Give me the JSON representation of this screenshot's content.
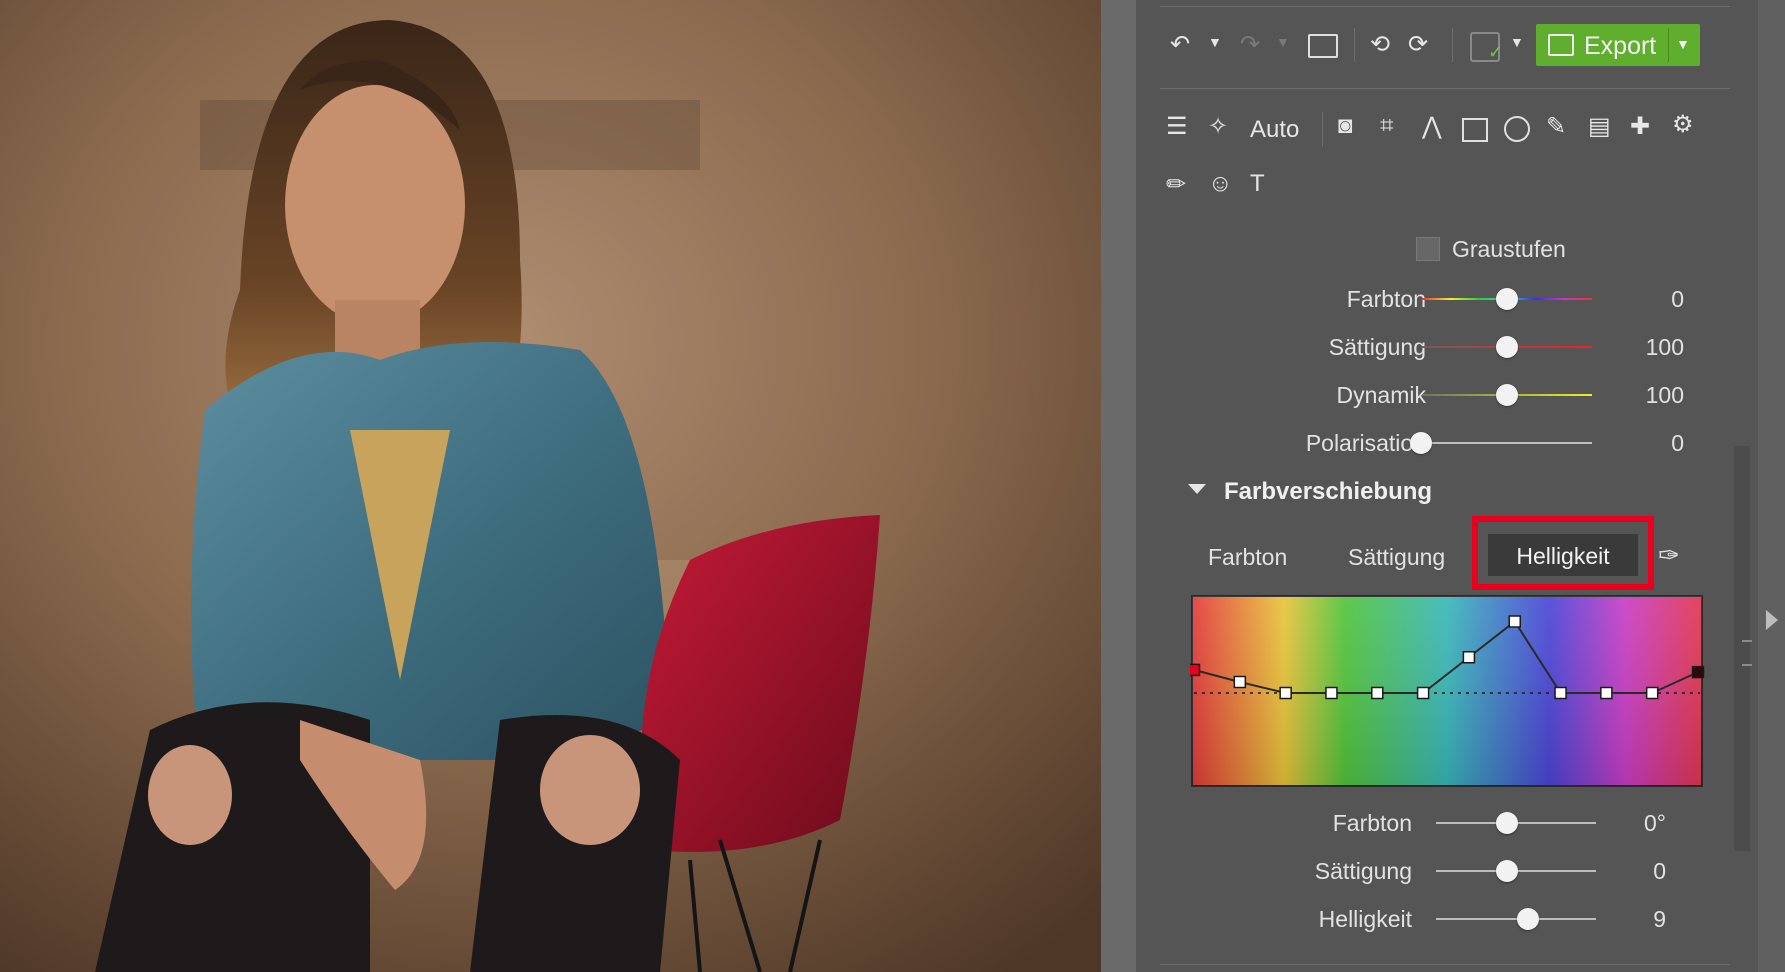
{
  "toolbar": {
    "export_label": "Export",
    "auto_label": "Auto"
  },
  "graustufen": {
    "label": "Graustufen",
    "checked": false
  },
  "adjustments": [
    {
      "label": "Farbton",
      "value": "0",
      "level": 0.5
    },
    {
      "label": "Sättigung",
      "value": "100",
      "level": 0.5
    },
    {
      "label": "Dynamik",
      "value": "100",
      "level": 0.5
    },
    {
      "label": "Polarisation",
      "value": "0",
      "level": 0.0
    }
  ],
  "farbverschiebung": {
    "title": "Farbverschiebung",
    "tabs": [
      "Farbton",
      "Sättigung",
      "Helligkeit"
    ],
    "active_tab": "Helligkeit",
    "curve_levels": [
      0.42,
      0.2,
      0.0,
      0.0,
      0.0,
      0.0,
      0.65,
      1.3,
      0.0,
      0.0,
      0.0,
      0.38
    ],
    "sliders": [
      {
        "label": "Farbton",
        "value": "0°",
        "level": 0.5
      },
      {
        "label": "Sättigung",
        "value": "0",
        "level": 0.5
      },
      {
        "label": "Helligkeit",
        "value": "9",
        "level": 0.63
      }
    ]
  },
  "colors": {
    "panel": "#555555",
    "export_green": "#5fae2e",
    "highlight": "#e8001c"
  }
}
